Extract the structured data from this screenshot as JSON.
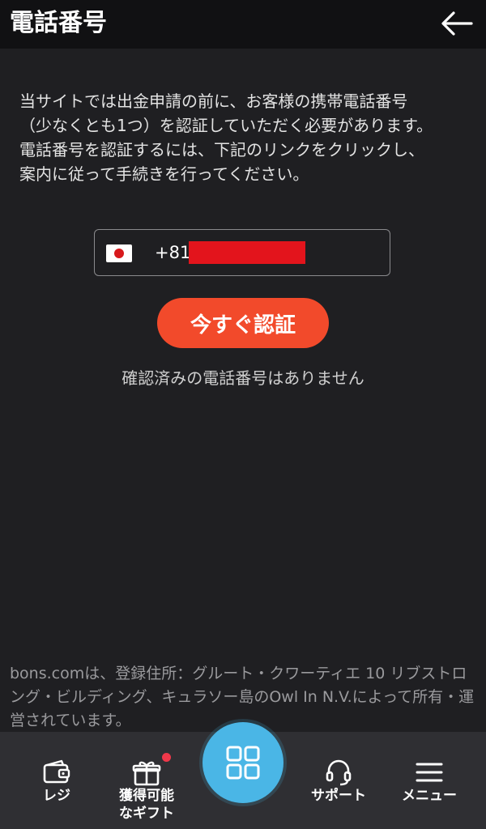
{
  "header": {
    "title": "電話番号"
  },
  "description": "当サイトでは出金申請の前に、お客様の携帯電話番号\n（少なくとも1つ）を認証していただく必要があります。\n電話番号を認証するには、下記のリンクをクリックし、\n案内に従って手続きを行ってください。",
  "phone": {
    "country_code": "+81",
    "flag": "japan-flag"
  },
  "verify_button": {
    "label": "今すぐ認証"
  },
  "status_text": "確認済みの電話番号はありません",
  "footer_text": "bons.comは、登録住所：グルート・クワーティエ 10 リブストロング・ビルディング、キュラソー島のOwl In N.V.によって所有・運営されています。",
  "tabbar": {
    "tabs": [
      {
        "label": "レジ",
        "icon": "wallet-icon"
      },
      {
        "label": "獲得可能\nなギフト",
        "icon": "gift-icon"
      },
      {
        "label": "サポート",
        "icon": "headset-icon"
      },
      {
        "label": "メニュー",
        "icon": "menu-icon"
      }
    ],
    "center_icon": "grid-icon"
  },
  "colors": {
    "background": "#1f1f22",
    "header": "#111113",
    "accent": "#f24a2b",
    "center_button": "#4ab6e6",
    "badge": "#f0384a"
  }
}
